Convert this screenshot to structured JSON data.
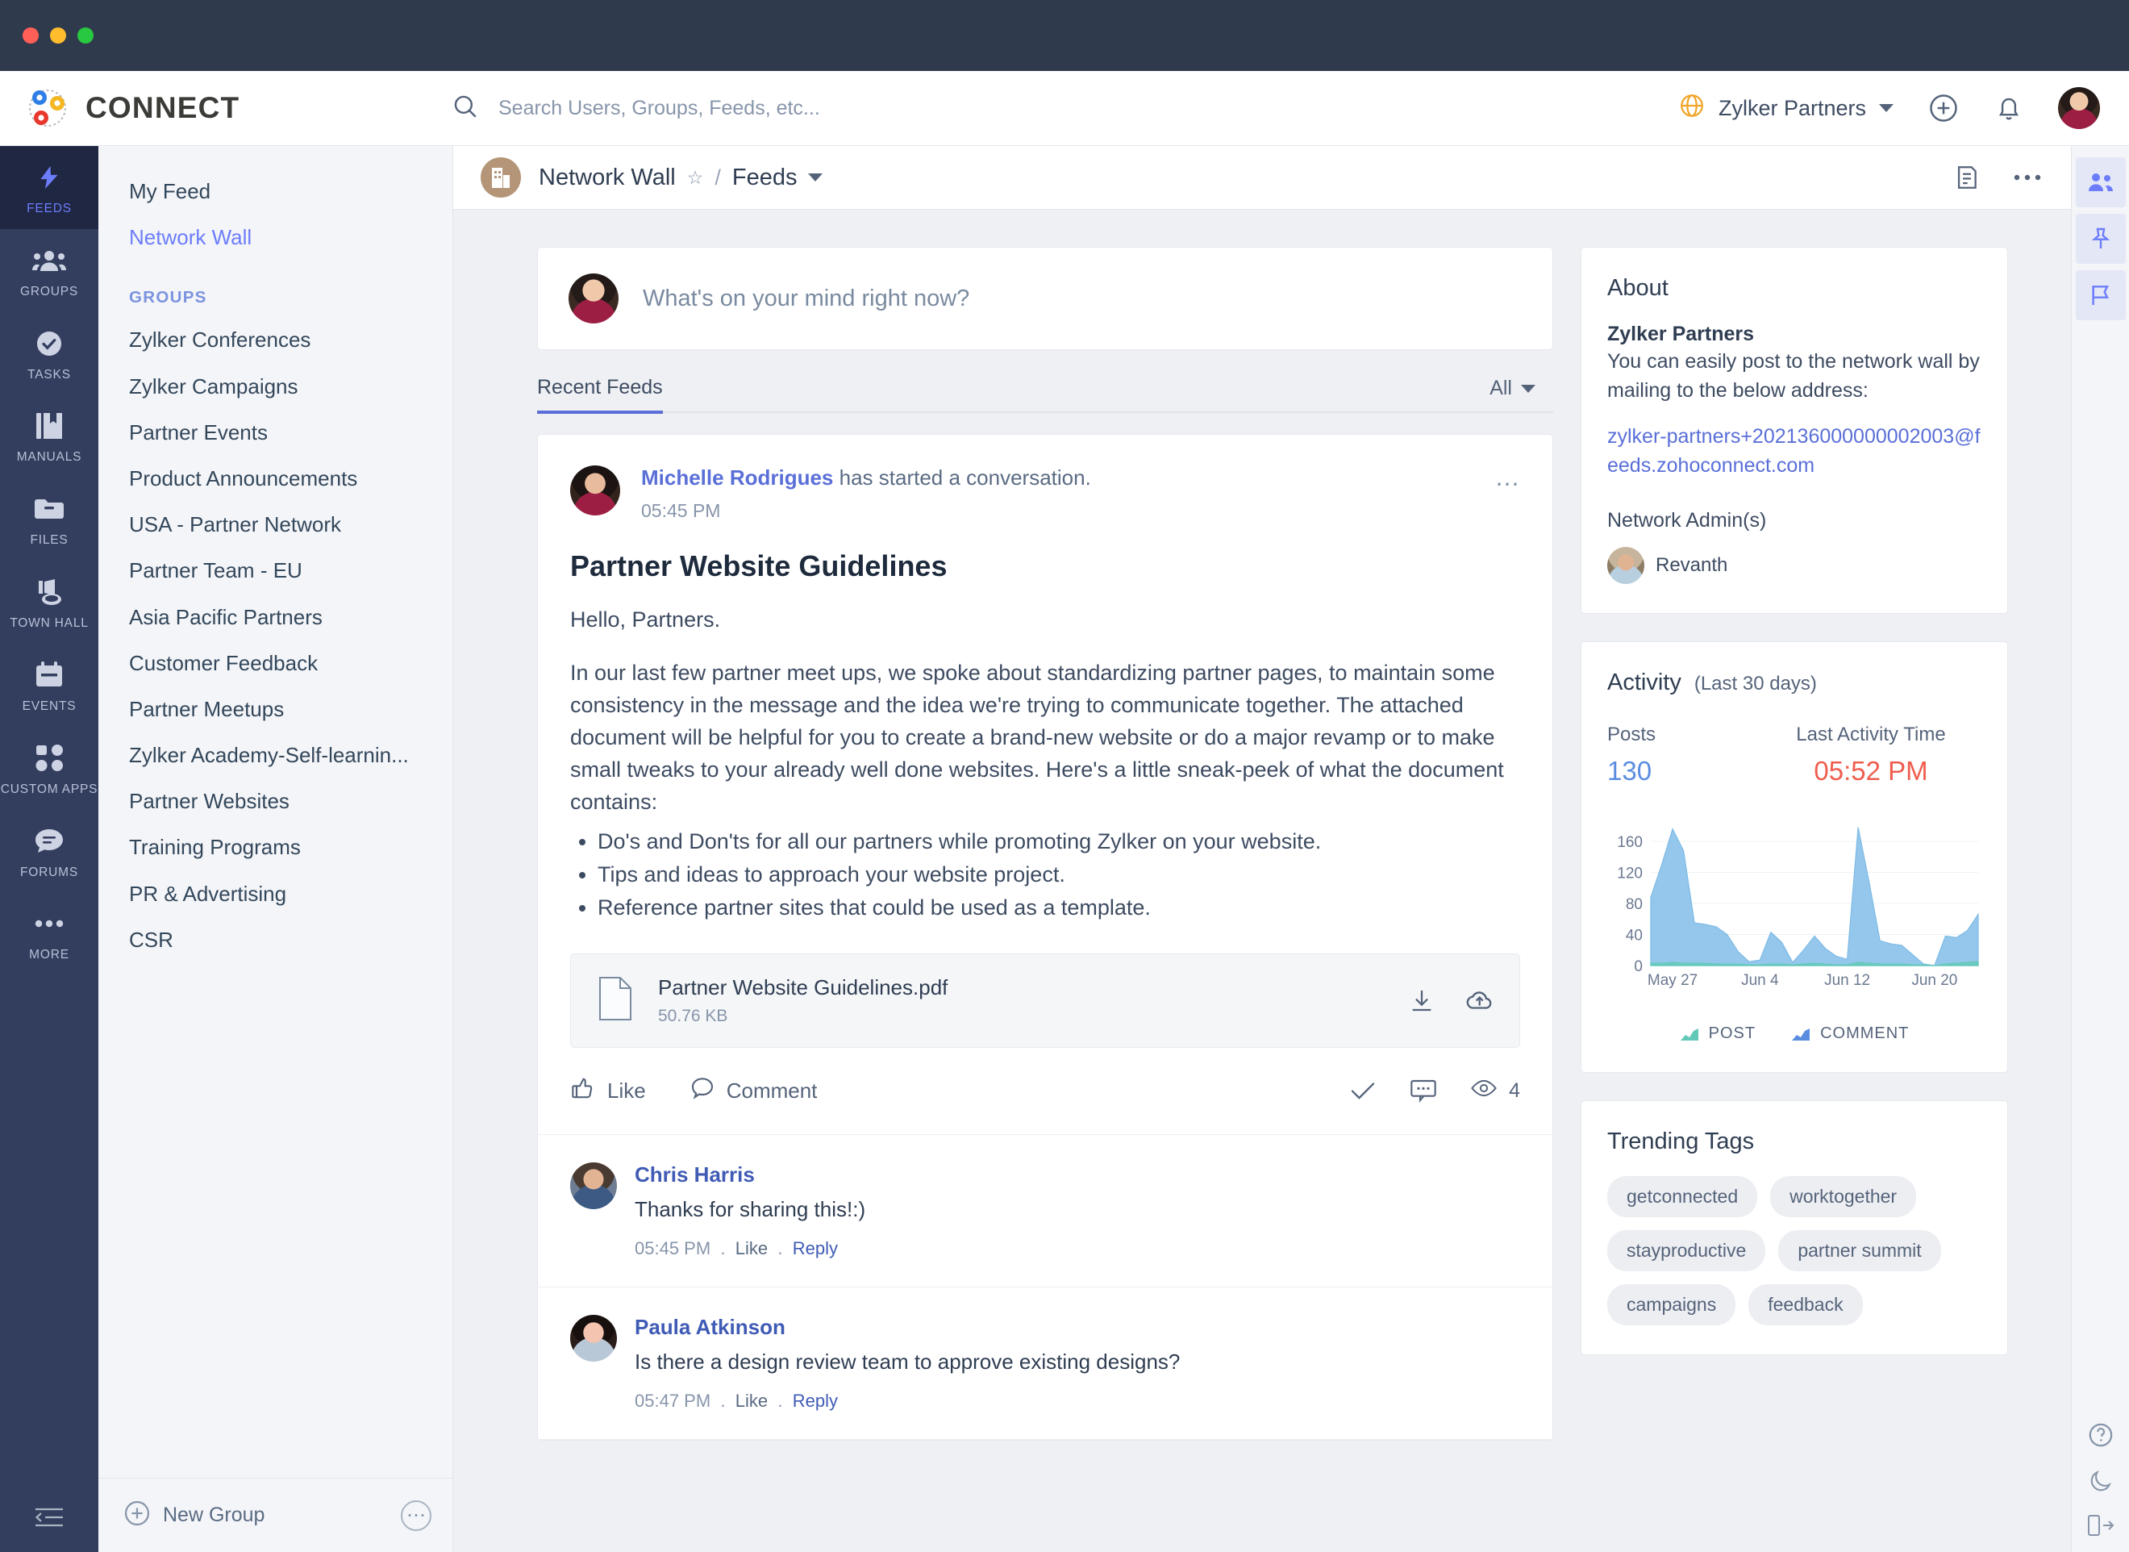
{
  "window": {
    "traffic_lights": [
      "close",
      "minimize",
      "maximize"
    ]
  },
  "header": {
    "brand": "CONNECT",
    "logo_icon": "connect-logo-icon",
    "search": {
      "icon": "search-icon",
      "placeholder": "Search Users, Groups, Feeds, etc...",
      "value": ""
    },
    "network": {
      "icon": "globe-icon",
      "name": "Zylker Partners",
      "chevron": "chevron-down-icon"
    },
    "add_icon": "plus-circle-icon",
    "notifications_icon": "bell-icon",
    "user_avatar": "user-avatar"
  },
  "rail": {
    "items": [
      {
        "label": "FEEDS",
        "icon": "lightning-icon",
        "active": true
      },
      {
        "label": "GROUPS",
        "icon": "people-icon",
        "active": false
      },
      {
        "label": "TASKS",
        "icon": "check-circle-icon",
        "active": false
      },
      {
        "label": "MANUALS",
        "icon": "book-icon",
        "active": false
      },
      {
        "label": "FILES",
        "icon": "folder-icon",
        "active": false
      },
      {
        "label": "TOWN HALL",
        "icon": "megaphone-icon",
        "active": false
      },
      {
        "label": "EVENTS",
        "icon": "calendar-icon",
        "active": false
      },
      {
        "label": "CUSTOM APPS",
        "icon": "apps-grid-icon",
        "active": false
      },
      {
        "label": "FORUMS",
        "icon": "speech-bubble-icon",
        "active": false
      },
      {
        "label": "MORE",
        "icon": "ellipsis-icon",
        "active": false
      }
    ],
    "collapse_icon": "collapse-panel-icon"
  },
  "sidebar": {
    "top_links": [
      {
        "label": "My Feed",
        "selected": false
      },
      {
        "label": "Network Wall",
        "selected": true
      }
    ],
    "groups_heading": "GROUPS",
    "groups": [
      "Zylker Conferences",
      "Zylker Campaigns",
      "Partner Events",
      "Product Announcements",
      "USA - Partner Network",
      "Partner Team - EU",
      "Asia Pacific Partners",
      "Customer Feedback",
      "Partner Meetups",
      "Zylker Academy-Self-learnin...",
      "Partner Websites",
      "Training Programs",
      "PR & Advertising",
      "CSR"
    ],
    "footer": {
      "new_group_label": "New Group",
      "new_group_icon": "plus-circle-icon",
      "overflow_icon": "ellipsis-icon"
    }
  },
  "breadcrumb": {
    "group_icon": "building-icon",
    "title": "Network Wall",
    "star_icon": "star-outline-icon",
    "separator": "/",
    "section": "Feeds",
    "section_chevron": "chevron-down-icon",
    "actions": [
      {
        "icon": "notes-icon",
        "name": "notes-button"
      },
      {
        "icon": "ellipsis-icon",
        "name": "more-options-button"
      }
    ]
  },
  "composer": {
    "avatar": "user-avatar",
    "placeholder": "What's on your mind right now?"
  },
  "feed_tabs": {
    "active_tab": "Recent Feeds",
    "filter_label": "All",
    "filter_chevron": "chevron-down-icon"
  },
  "post": {
    "avatar": "author-avatar",
    "author": "Michelle Rodrigues",
    "action_text": " has started a conversation.",
    "time": "05:45 PM",
    "more_icon": "ellipsis-icon",
    "title": "Partner Website Guidelines",
    "greeting": "Hello, Partners.",
    "body": "In our last few partner meet ups, we spoke about standardizing partner pages, to maintain some consistency in the message and the idea we're trying to communicate together. The attached document will be helpful for you to create a brand-new website or do a major revamp or to make small tweaks to your already well done websites. Here's a little sneak-peek of what the document contains:",
    "bullets": [
      "Do's and Don'ts for all our partners while promoting Zylker on your website.",
      "Tips and ideas to approach your website project.",
      "Reference partner sites that could be used as a template."
    ],
    "attachment": {
      "file_icon": "file-document-icon",
      "name": "Partner Website Guidelines.pdf",
      "size": "50.76 KB",
      "download_icon": "download-icon",
      "cloud_icon": "cloud-upload-icon"
    },
    "actions": {
      "like_label": "Like",
      "like_icon": "thumbs-up-icon",
      "comment_label": "Comment",
      "comment_icon": "speech-bubble-icon",
      "check_icon": "check-icon",
      "announce_icon": "comment-dots-icon",
      "views_icon": "eye-icon",
      "views_count": "4"
    }
  },
  "comments": [
    {
      "avatar": "chris-avatar",
      "name": "Chris Harris",
      "text": "Thanks for sharing this!:)",
      "time": "05:45 PM",
      "like_label": "Like",
      "reply_label": "Reply"
    },
    {
      "avatar": "paula-avatar",
      "name": "Paula Atkinson",
      "text": "Is there a design review team to approve existing designs?",
      "time": "05:47 PM",
      "like_label": "Like",
      "reply_label": "Reply"
    }
  ],
  "about": {
    "title": "About",
    "network_name": "Zylker Partners",
    "description": "You can easily post to the network wall by mailing to the below address:",
    "email": "zylker-partners+202136000000002003@feeds.zohoconnect.com",
    "admins_label": "Network Admin(s)",
    "admins": [
      {
        "name": "Revanth",
        "avatar": "revanth-avatar"
      }
    ]
  },
  "activity": {
    "title": "Activity",
    "subtitle": "(Last 30 days)",
    "posts_label": "Posts",
    "posts_value": "130",
    "last_activity_label": "Last Activity Time",
    "last_activity_value": "05:52 PM",
    "legend": [
      {
        "label": "POST",
        "color": "#62c9b8",
        "icon": "area-chart-icon"
      },
      {
        "label": "COMMENT",
        "color": "#5a8de0",
        "icon": "area-chart-icon"
      }
    ]
  },
  "chart_data": {
    "type": "area",
    "title": "Activity (Last 30 days)",
    "xlabel": "",
    "ylabel": "",
    "ylim": [
      0,
      185
    ],
    "yticks": [
      0,
      40,
      80,
      120,
      160
    ],
    "xticks": [
      "May 27",
      "Jun 4",
      "Jun 12",
      "Jun 20"
    ],
    "grid": true,
    "legend_position": "bottom",
    "x": [
      "May 25",
      "May 26",
      "May 27",
      "May 28",
      "May 29",
      "May 30",
      "May 31",
      "Jun 1",
      "Jun 2",
      "Jun 3",
      "Jun 4",
      "Jun 5",
      "Jun 6",
      "Jun 7",
      "Jun 8",
      "Jun 9",
      "Jun 10",
      "Jun 11",
      "Jun 12",
      "Jun 13",
      "Jun 14",
      "Jun 15",
      "Jun 16",
      "Jun 17",
      "Jun 18",
      "Jun 19",
      "Jun 20",
      "Jun 21",
      "Jun 22",
      "Jun 23",
      "Jun 24"
    ],
    "series": [
      {
        "name": "COMMENT",
        "color": "#7dbbe6",
        "values": [
          88,
          130,
          176,
          148,
          55,
          53,
          50,
          40,
          18,
          5,
          7,
          43,
          30,
          4,
          20,
          38,
          22,
          12,
          8,
          178,
          108,
          32,
          28,
          26,
          14,
          2,
          0,
          38,
          36,
          45,
          66
        ]
      },
      {
        "name": "POST",
        "color": "#62c9b8",
        "values": [
          3,
          3,
          4,
          3,
          3,
          3,
          2,
          2,
          2,
          1,
          1,
          2,
          2,
          1,
          2,
          3,
          2,
          1,
          1,
          4,
          3,
          2,
          2,
          2,
          1,
          1,
          0,
          2,
          3,
          4,
          5
        ]
      }
    ]
  },
  "trending": {
    "title": "Trending Tags",
    "tags": [
      "getconnected",
      "worktogether",
      "stayproductive",
      "partner summit",
      "campaigns",
      "feedback"
    ]
  },
  "utility_rail": {
    "buttons": [
      {
        "icon": "members-icon",
        "name": "members-button",
        "selected": true
      },
      {
        "icon": "pinned-icon",
        "name": "pinned-button",
        "selected": true
      },
      {
        "icon": "flag-icon",
        "name": "flagged-button",
        "selected": true
      }
    ],
    "bottom_buttons": [
      {
        "icon": "help-circle-icon",
        "name": "help-button"
      },
      {
        "icon": "moon-icon",
        "name": "dark-mode-button"
      },
      {
        "icon": "logout-icon",
        "name": "expand-button"
      }
    ]
  },
  "colors": {
    "accent": "#6c7dfb",
    "rail_bg": "#333d5e",
    "rail_active_bg": "#1f2743",
    "titlebar": "#303a4d",
    "stage_bg": "#eef0f4",
    "link": "#5a6fd8",
    "chart_comment": "#7dbbe6",
    "chart_post": "#62c9b8",
    "alert": "#ef5d4e"
  }
}
